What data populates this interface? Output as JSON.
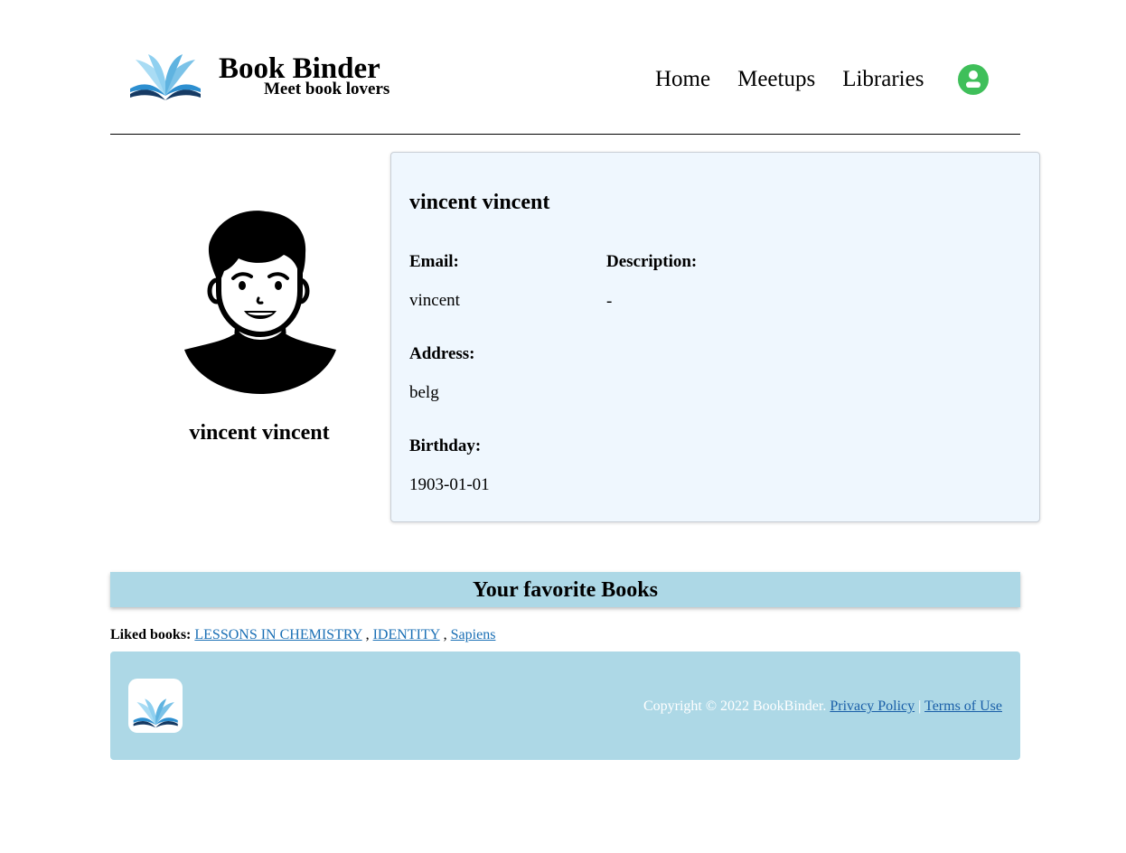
{
  "header": {
    "brand_title": "Book Binder",
    "brand_tagline": "Meet book lovers",
    "logo_icon": "open-book-icon",
    "nav": [
      {
        "label": "Home"
      },
      {
        "label": "Meetups"
      },
      {
        "label": "Libraries"
      }
    ],
    "user_icon": "user-circle-icon",
    "user_icon_color": "#3fbf5a"
  },
  "profile": {
    "name": "vincent vincent",
    "avatar_icon": "person-avatar-icon",
    "card_name": "vincent vincent",
    "email_label": "Email:",
    "email_value": "vincent",
    "description_label": "Description:",
    "description_value": "-",
    "address_label": "Address:",
    "address_value": "belg",
    "birthday_label": "Birthday:",
    "birthday_value": "1903-01-01",
    "card_bg": "#eff7fe"
  },
  "favorites": {
    "heading": "Your favorite Books",
    "liked_label": "Liked books:",
    "books": [
      "LESSONS IN CHEMISTRY",
      "IDENTITY",
      "Sapiens"
    ],
    "separator": ",",
    "bar_color": "#add8e6"
  },
  "footer": {
    "copyright": "Copyright © 2022 BookBinder.",
    "privacy_label": "Privacy Policy",
    "divider": "|",
    "terms_label": "Terms of Use",
    "logo_icon": "open-book-icon",
    "bg_color": "#add8e6"
  }
}
